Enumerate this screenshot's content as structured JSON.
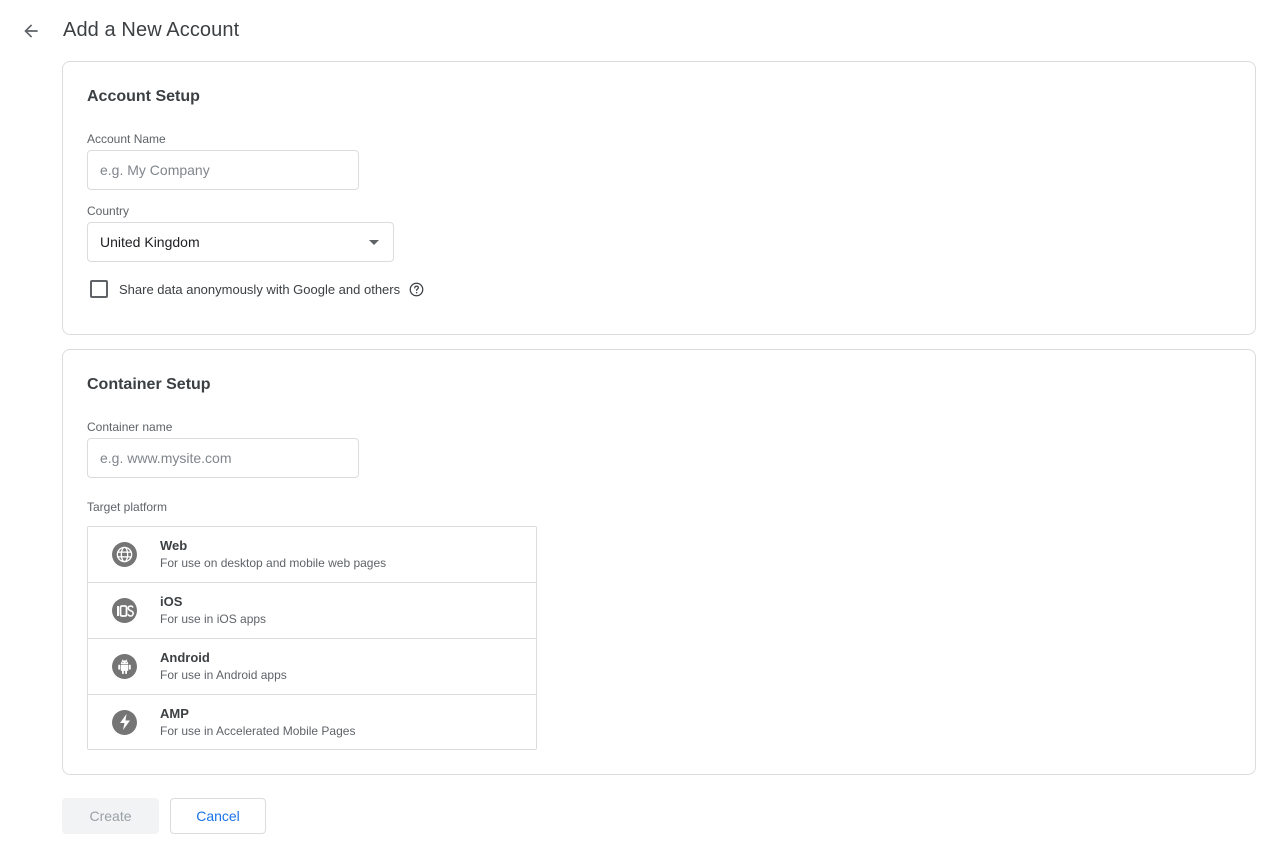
{
  "page": {
    "title": "Add a New Account"
  },
  "account_setup": {
    "title": "Account Setup",
    "account_name_label": "Account Name",
    "account_name_value": "",
    "account_name_placeholder": "e.g. My Company",
    "country_label": "Country",
    "country_value": "United Kingdom",
    "share_data_label": "Share data anonymously with Google and others",
    "share_data_checked": false
  },
  "container_setup": {
    "title": "Container Setup",
    "container_name_label": "Container name",
    "container_name_value": "",
    "container_name_placeholder": "e.g. www.mysite.com",
    "target_platform_label": "Target platform",
    "platforms": [
      {
        "name": "Web",
        "description": "For use on desktop and mobile web pages",
        "icon": "globe-icon"
      },
      {
        "name": "iOS",
        "description": "For use in iOS apps",
        "icon": "ios-icon"
      },
      {
        "name": "Android",
        "description": "For use in Android apps",
        "icon": "android-icon"
      },
      {
        "name": "AMP",
        "description": "For use in Accelerated Mobile Pages",
        "icon": "lightning-bolt-icon"
      }
    ]
  },
  "actions": {
    "create_label": "Create",
    "cancel_label": "Cancel"
  },
  "colors": {
    "primary": "#1a73e8",
    "border": "#dadce0",
    "icon_gray": "#757575"
  }
}
